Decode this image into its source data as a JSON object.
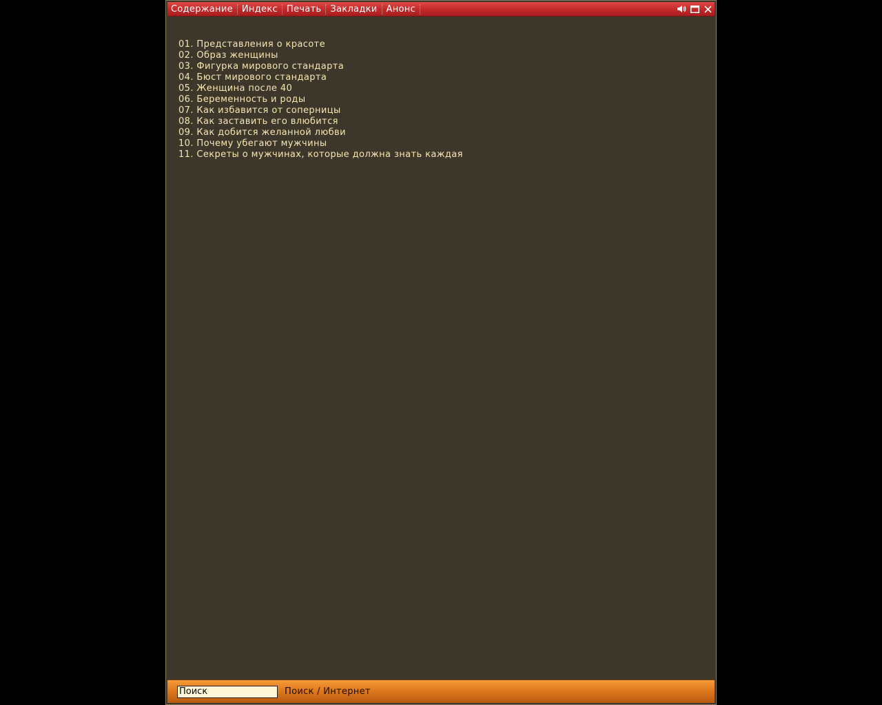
{
  "menu": {
    "items": [
      {
        "id": "contents",
        "label": "Содержание"
      },
      {
        "id": "index",
        "label": "Индекс"
      },
      {
        "id": "print",
        "label": "Печать"
      },
      {
        "id": "bookmarks",
        "label": "Закладки"
      },
      {
        "id": "announce",
        "label": "Анонс"
      }
    ]
  },
  "controls": {
    "icons": [
      "speaker-icon",
      "maximize-icon",
      "close-icon"
    ]
  },
  "toc": {
    "items": [
      "01. Представления о красоте",
      "02. Образ женщины",
      "03. Фигурка мирового стандарта",
      "04. Бюст мирового стандарта",
      "05. Женщина после 40",
      "06. Беременность и роды",
      "07. Как избавится от соперницы",
      "08. Как заставить его влюбится",
      "09. Как добится желанной любви",
      "10. Почему убегают мужчины",
      "11. Секреты о мужчинах, которые должна знать каждая"
    ]
  },
  "search": {
    "value": "Поиск",
    "link_label": "Поиск / Интернет"
  },
  "colors": {
    "background": "#3d362b",
    "text": "#f5e7b0",
    "topbar": "#c42b2b",
    "bottombar": "#e07a1e"
  }
}
